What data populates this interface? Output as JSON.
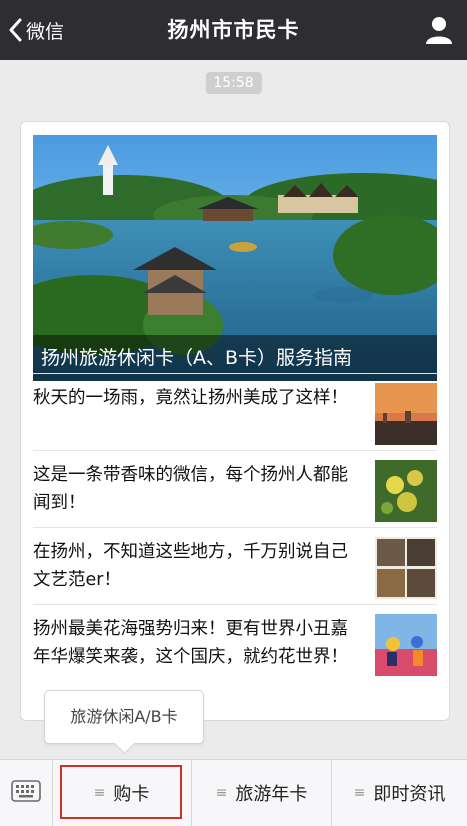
{
  "navbar": {
    "back_label": "微信",
    "title": "扬州市市民卡",
    "back_icon": "chevron-left-icon",
    "profile_icon": "person-icon"
  },
  "chat": {
    "timestamp": "15:58"
  },
  "cover_article": {
    "title": "扬州旅游休闲卡（A、B卡）服务指南"
  },
  "articles": [
    {
      "title": "秋天的一场雨，竟然让扬州美成了这样！"
    },
    {
      "title": "这是一条带香味的微信，每个扬州人都能闻到！"
    },
    {
      "title": "在扬州，不知道这些地方，千万别说自己文艺范er！"
    },
    {
      "title": "扬州最美花海强势归来！更有世界小丑嘉年华爆笑来袭，这个国庆，就约花世界！"
    }
  ],
  "popup_menu": {
    "items": [
      "旅游休闲A/B卡"
    ]
  },
  "bottom_menu": {
    "keyboard_icon": "keyboard-icon",
    "items": [
      {
        "label": "购卡"
      },
      {
        "label": "旅游年卡"
      },
      {
        "label": "即时资讯"
      }
    ],
    "menu_icon": "menu-lines-icon"
  },
  "colors": {
    "navbar_bg": "#2e2e32",
    "highlight_border": "#d0302a"
  }
}
